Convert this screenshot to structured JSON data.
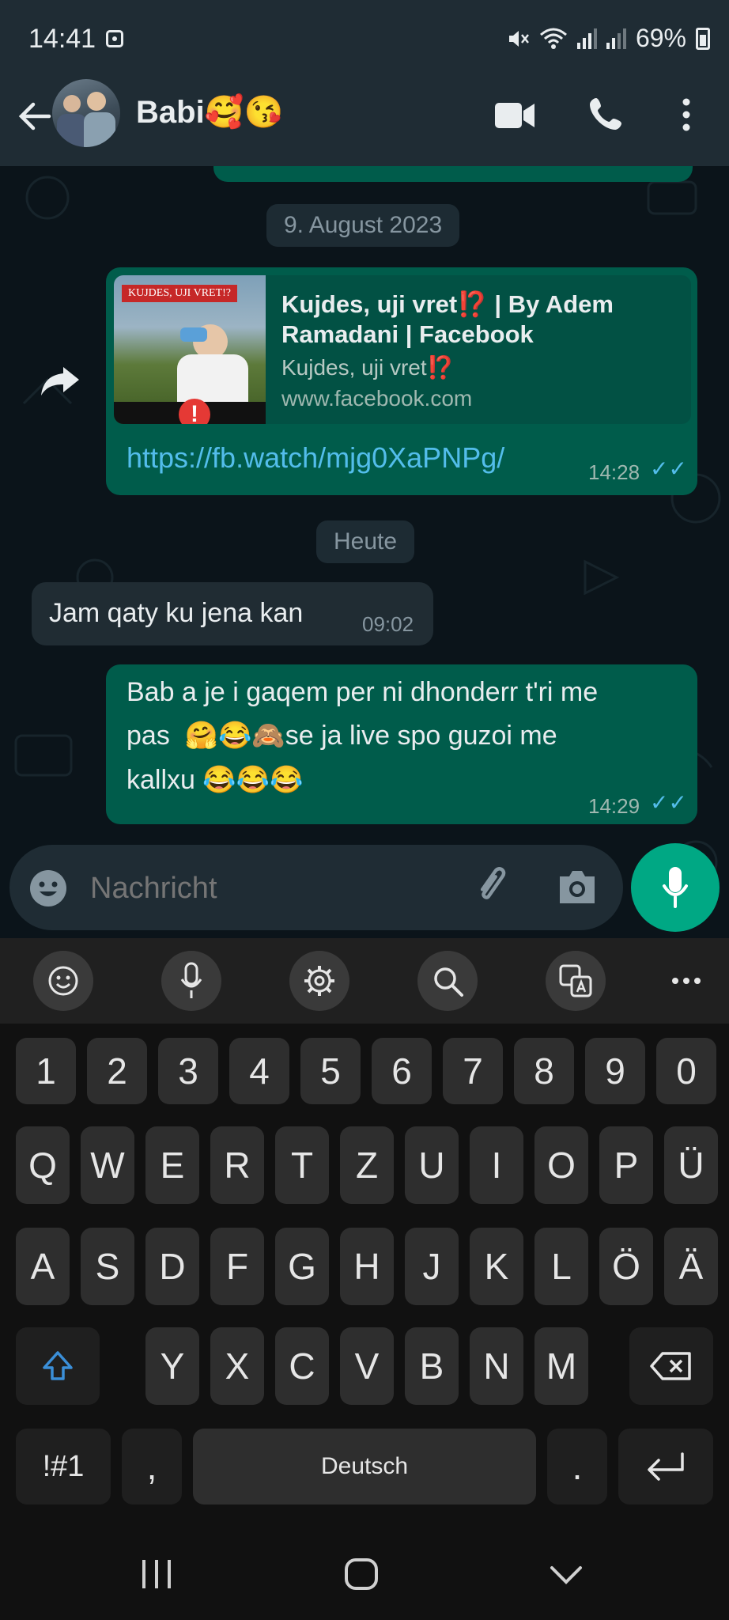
{
  "status": {
    "time": "14:41",
    "battery": "69%"
  },
  "header": {
    "contact_name": "Babi🥰😘"
  },
  "chat": {
    "date_1": "9. August 2023",
    "link_message": {
      "preview_title": "Kujdes, uji vret⁉️ | By Adem Ramadani | Facebook",
      "preview_desc": "Kujdes, uji vret⁉️",
      "preview_domain": "www.facebook.com",
      "thumb_caption": "KUJDES, UJI VRET!?",
      "url": "https://fb.watch/mjg0XaPNPg/",
      "time": "14:28"
    },
    "date_2": "Heute",
    "incoming": {
      "text": "Jam qaty ku jena kan",
      "time": "09:02"
    },
    "outgoing": {
      "line1": "Bab a je i gaqem per ni dhonderr t'ri me",
      "line2": "pas  🤗😂🙈se ja live spo guzoi me",
      "line3": "kallxu 😂😂😂",
      "time": "14:29"
    }
  },
  "composer": {
    "placeholder": "Nachricht"
  },
  "keyboard": {
    "row_numbers": [
      "1",
      "2",
      "3",
      "4",
      "5",
      "6",
      "7",
      "8",
      "9",
      "0"
    ],
    "row1": [
      "Q",
      "W",
      "E",
      "R",
      "T",
      "Z",
      "U",
      "I",
      "O",
      "P",
      "Ü"
    ],
    "row2": [
      "A",
      "S",
      "D",
      "F",
      "G",
      "H",
      "J",
      "K",
      "L",
      "Ö",
      "Ä"
    ],
    "row3": [
      "Y",
      "X",
      "C",
      "V",
      "B",
      "N",
      "M"
    ],
    "symbols_key": "!#1",
    "comma_key": ",",
    "space_label": "Deutsch",
    "period_key": "."
  },
  "colors": {
    "accent": "#00a884",
    "outgoing_bubble": "#005c4b",
    "incoming_bubble": "#202c33",
    "read_ticks": "#53bdeb",
    "link": "#53bdeb"
  }
}
